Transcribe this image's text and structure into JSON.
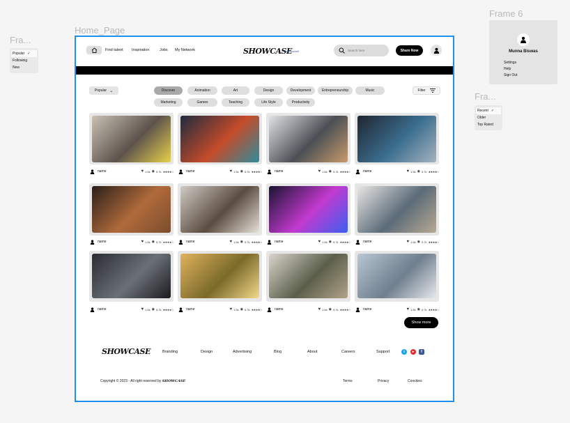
{
  "canvas_labels": {
    "frame_left": "Fra...",
    "home_page": "Home_Page",
    "frame6": "Frame 6",
    "frame_right": "Fra..."
  },
  "sort_menu_left": {
    "items": [
      "Popular",
      "Following",
      "New"
    ],
    "selected": "Popular"
  },
  "sort_menu_right": {
    "items": [
      "Recent",
      "Older",
      "Top Rated"
    ],
    "selected": "Recent"
  },
  "profile_menu": {
    "name": "Munna Biswas",
    "items": [
      "Settings",
      "Help",
      "Sign Out"
    ]
  },
  "header": {
    "nav": [
      "Find talent",
      "Inspiration",
      "Jobs",
      "My Network"
    ],
    "logo": "SHOWCASE",
    "tagline": "Show yourself",
    "search_placeholder": "Search here",
    "share_label": "Share Now"
  },
  "filters": {
    "sort_label": "Popular",
    "filter_label": "Filter",
    "categories_row1": [
      "Discover",
      "Animation",
      "Art",
      "Design",
      "Development",
      "Entrepreneurship",
      "Music"
    ],
    "categories_row2": [
      "Marketing",
      "Games",
      "Teaching",
      "Life Style",
      "Productivity"
    ],
    "active": "Discover"
  },
  "cards": [
    {
      "name": "name",
      "likes": "1.5k",
      "views": "5.7k",
      "scene": "office meeting",
      "rating": 4
    },
    {
      "name": "name",
      "likes": "1.5k",
      "views": "5.7k",
      "scene": "colorful painting",
      "rating": 4
    },
    {
      "name": "name",
      "likes": "1.6k",
      "views": "5.7k",
      "scene": "designer at monitor",
      "rating": 4
    },
    {
      "name": "name",
      "likes": "1.5k",
      "views": "5.7k",
      "scene": "coder at screens",
      "rating": 4
    },
    {
      "name": "name",
      "likes": "1.5k",
      "views": "5.7k",
      "scene": "band performing",
      "rating": 4
    },
    {
      "name": "name",
      "likes": "1.5k",
      "views": "5.7k",
      "scene": "tablet charts",
      "rating": 4
    },
    {
      "name": "name",
      "likes": "1.5k",
      "views": "5.7k",
      "scene": "gaming setup",
      "rating": 4
    },
    {
      "name": "name",
      "likes": "1.5k",
      "views": "5.7k",
      "scene": "presentation",
      "rating": 4
    },
    {
      "name": "name",
      "likes": "1.5k",
      "views": "5.7k",
      "scene": "mechanic",
      "rating": 4
    },
    {
      "name": "name",
      "likes": "1.5k",
      "views": "5.7k",
      "scene": "field sunset",
      "rating": 4
    },
    {
      "name": "name",
      "likes": "1.6k",
      "views": "5.7k",
      "scene": "wheelchair desk",
      "rating": 4
    },
    {
      "name": "name",
      "likes": "1.5k",
      "views": "5.7k",
      "scene": "skateboard",
      "rating": 4
    }
  ],
  "show_more": "Show more",
  "footer": {
    "logo": "SHOWCASE",
    "links": [
      "Branding",
      "Design",
      "Advertising",
      "Blog",
      "About",
      "Careers",
      "Support"
    ],
    "copyright": "Copyright © 2023 - All right reserved by",
    "copyright_logo": "SHOWCASE",
    "legal": [
      "Terms",
      "Privacy",
      "Coockies"
    ]
  },
  "colors": {
    "frame_border": "#1e8ff0",
    "twitter": "#1da1f2",
    "youtube": "#e52d27",
    "facebook": "#3b5998"
  }
}
